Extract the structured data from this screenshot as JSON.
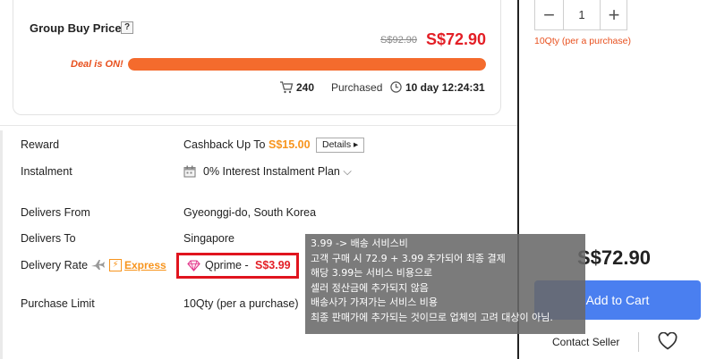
{
  "group_buy": {
    "title": "Group Buy Price",
    "help_icon": "?",
    "old_price": "S$92.90",
    "new_price": "S$72.90",
    "deal_label": "Deal is ON!",
    "deal_progress_percent": 100,
    "purchased_count": "240",
    "purchased_label": "Purchased",
    "timer": "10 day 12:24:31",
    "colors": {
      "price": "#e31f26",
      "bar": "#f46b2d",
      "deal": "#e8501e"
    }
  },
  "info": {
    "reward": {
      "label": "Reward",
      "value_prefix": "Cashback Up To",
      "value_amount": "S$15.00",
      "details_button": "Details ▸"
    },
    "instalment": {
      "label": "Instalment",
      "value": "0% Interest Instalment Plan",
      "dropdown_icon": "⌵"
    },
    "delivers_from": {
      "label": "Delivers From",
      "value": "Gyeonggi-do, South Korea"
    },
    "delivers_to": {
      "label": "Delivers To",
      "value": "Singapore"
    },
    "delivery_rate": {
      "label": "Delivery Rate",
      "express": "Express",
      "express_badge": "⚡",
      "qprime_label": "Qprime -",
      "qprime_price": "S$3.99"
    },
    "purchase_limit": {
      "label": "Purchase Limit",
      "value": "10Qty (per a purchase)"
    }
  },
  "right_panel": {
    "qty_minus": "−",
    "qty_value": "1",
    "qty_plus": "+",
    "qty_note": "10Qty (per a purchase)",
    "total_price": "S$72.90",
    "add_to_cart": "Add to Cart",
    "contact_seller": "Contact Seller",
    "accent_color": "#4a7ff0"
  },
  "note": {
    "lines": [
      "3.99 -> 배송 서비스비",
      "고객 구매 시 72.9 + 3.99 추가되어 최종 결제",
      "해당 3.99는 서비스 비용으로",
      "셀러 정산금에 추가되지 않음",
      "배송사가 가져가는 서비스 비용",
      "최종 판매가에 추가되는 것이므로 업체의 고려 대상이 아님."
    ]
  }
}
